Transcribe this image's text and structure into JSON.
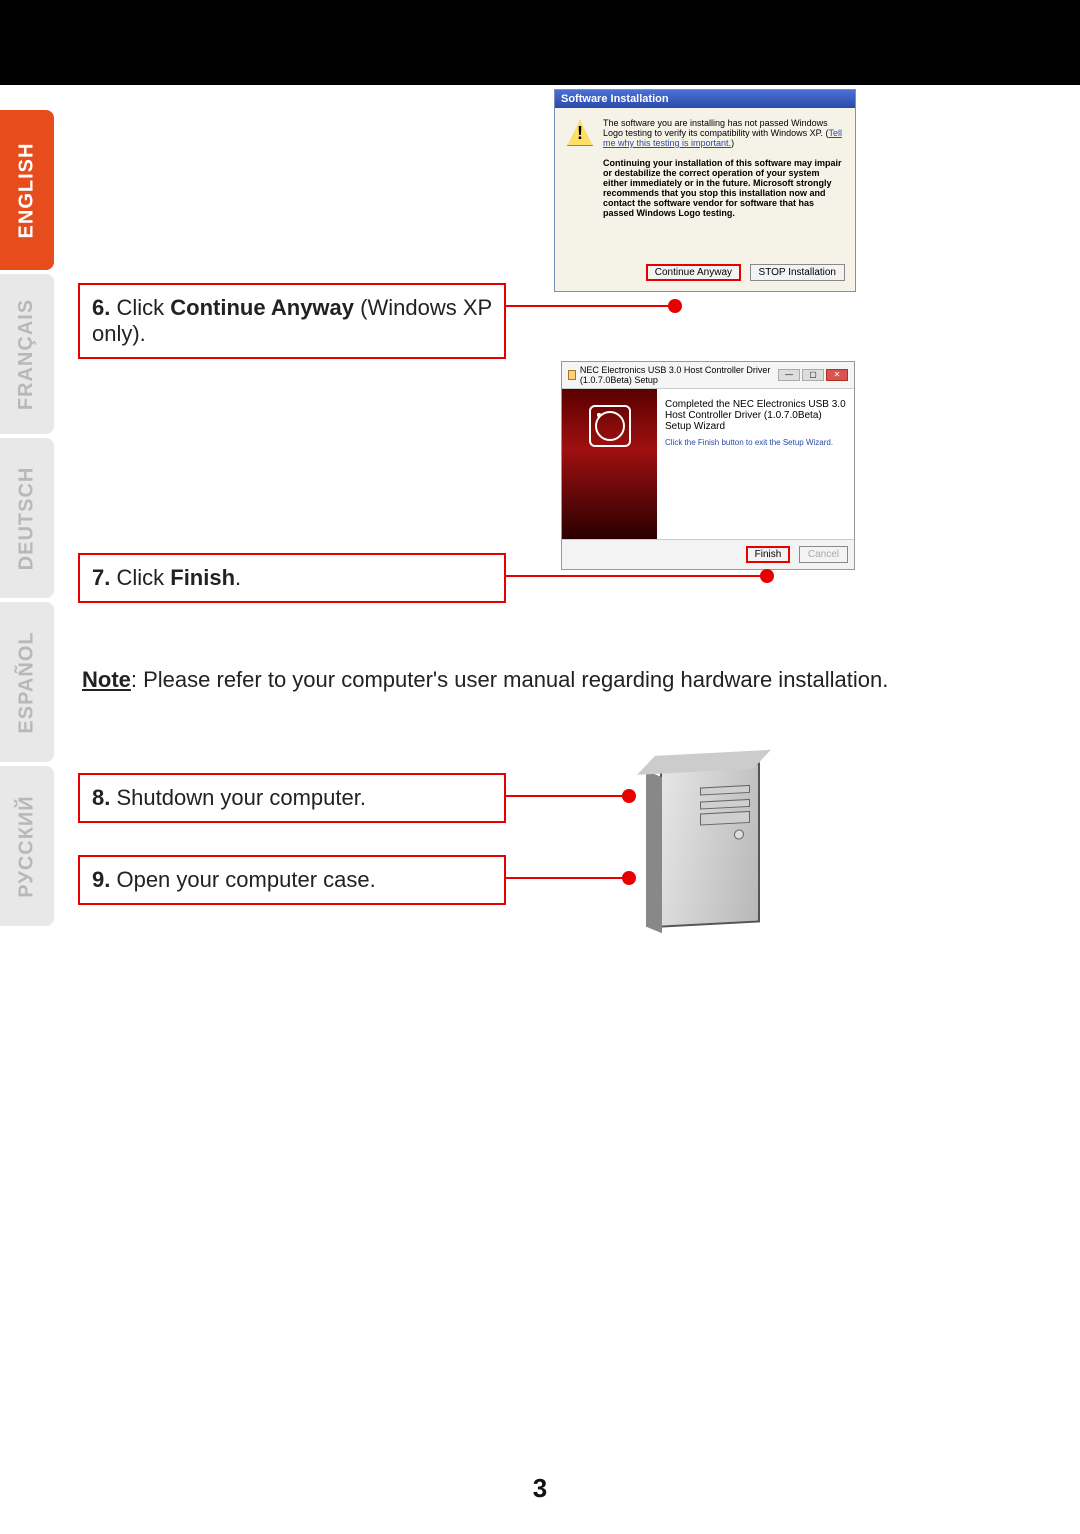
{
  "languages": {
    "en": "ENGLISH",
    "fr": "FRANÇAIS",
    "de": "DEUTSCH",
    "es": "ESPAÑOL",
    "ru": "РУССКИЙ"
  },
  "steps": {
    "s6": {
      "num": "6.",
      "pre": " Click ",
      "bold": "Continue Anyway",
      "post": " (Windows XP only)."
    },
    "s7": {
      "num": "7.",
      "pre": " Click ",
      "bold": "Finish",
      "post": "."
    },
    "s8": {
      "num": "8.",
      "text": " Shutdown your computer."
    },
    "s9": {
      "num": "9.",
      "text": " Open your computer case."
    }
  },
  "note": {
    "label": "Note",
    "text": ": Please refer to your computer's user manual regarding hardware installation."
  },
  "dialog_xp": {
    "title": "Software Installation",
    "warn_icon": "!",
    "line1": "The software you are installing has not passed Windows Logo testing to verify its compatibility with Windows XP.",
    "link": "Tell me why this testing is important.",
    "line2": "Continuing your installation of this software may impair or destabilize the correct operation of your system either immediately or in the future. Microsoft strongly recommends that you stop this installation now and contact the software vendor for software that has passed Windows Logo testing.",
    "btn_continue": "Continue Anyway",
    "btn_stop": "STOP Installation"
  },
  "dialog_wizard": {
    "title": "NEC Electronics USB 3.0 Host Controller Driver (1.0.7.0Beta) Setup",
    "heading": "Completed the NEC Electronics USB 3.0 Host Controller Driver (1.0.7.0Beta) Setup Wizard",
    "sub": "Click the Finish button to exit the Setup Wizard.",
    "btn_finish": "Finish",
    "btn_cancel": "Cancel"
  },
  "page_number": "3"
}
